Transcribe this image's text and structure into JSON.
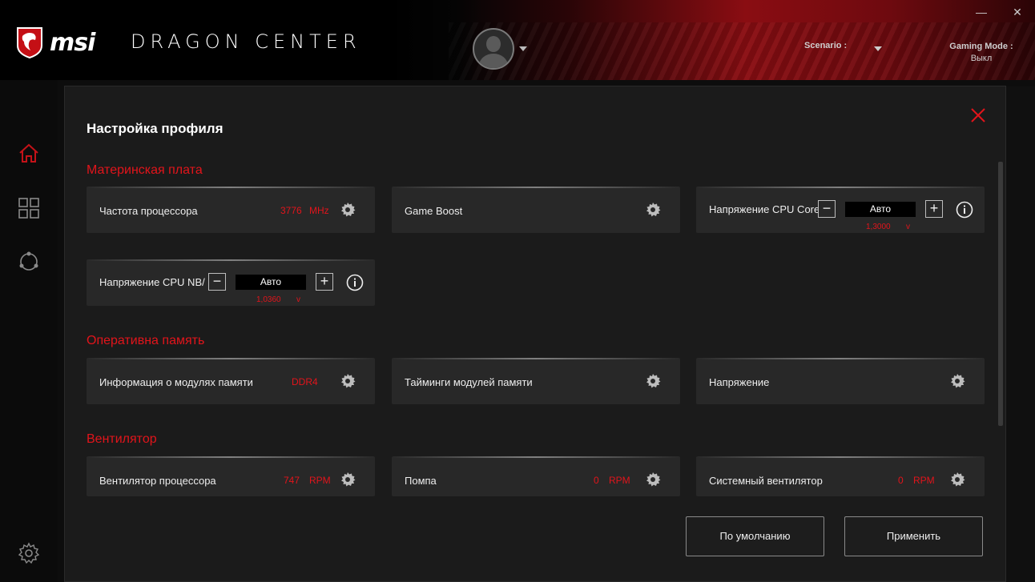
{
  "header": {
    "brand": "msi",
    "app_name": "DRAGON CENTER",
    "scenario_label": "Scenario :",
    "gaming_mode_label": "Gaming Mode :",
    "gaming_mode_value": "Выкл",
    "minimize_glyph": "—",
    "close_glyph": "✕"
  },
  "sidebar": {
    "items": [
      {
        "icon": "home-icon"
      },
      {
        "icon": "grid-icon"
      },
      {
        "icon": "network-icon"
      },
      {
        "icon": "settings-gear-icon"
      }
    ]
  },
  "modal": {
    "title": "Настройка профиля",
    "sections": {
      "motherboard": {
        "title": "Материнская плата",
        "cpu_freq": {
          "label": "Частота процессора",
          "value": "3776",
          "unit": "MHz"
        },
        "game_boost": {
          "label": "Game Boost"
        },
        "cpu_core_voltage": {
          "label": "Напряжение CPU Core",
          "field": "Авто",
          "current": "1,3000",
          "unit": "v"
        },
        "cpu_nb_voltage": {
          "label": "Напряжение CPU NB/",
          "field": "Авто",
          "current": "1,0360",
          "unit": "v"
        }
      },
      "memory": {
        "title": "Оперативна память",
        "modules_info": {
          "label": "Информация о модулях памяти",
          "value": "DDR4"
        },
        "timings": {
          "label": "Тайминги модулей памяти"
        },
        "voltage": {
          "label": "Напряжение"
        }
      },
      "fan": {
        "title": "Вентилятор",
        "cpu_fan": {
          "label": "Вентилятор процессора",
          "value": "747",
          "unit": "RPM"
        },
        "pump": {
          "label": "Помпа",
          "value": "0",
          "unit": "RPM"
        },
        "system_fan": {
          "label": "Системный вентилятор",
          "value": "0",
          "unit": "RPM"
        }
      }
    },
    "buttons": {
      "default": "По умолчанию",
      "apply": "Применить"
    }
  },
  "colors": {
    "accent": "#e2141b",
    "card": "#282828",
    "modal": "#1b1b1b"
  }
}
